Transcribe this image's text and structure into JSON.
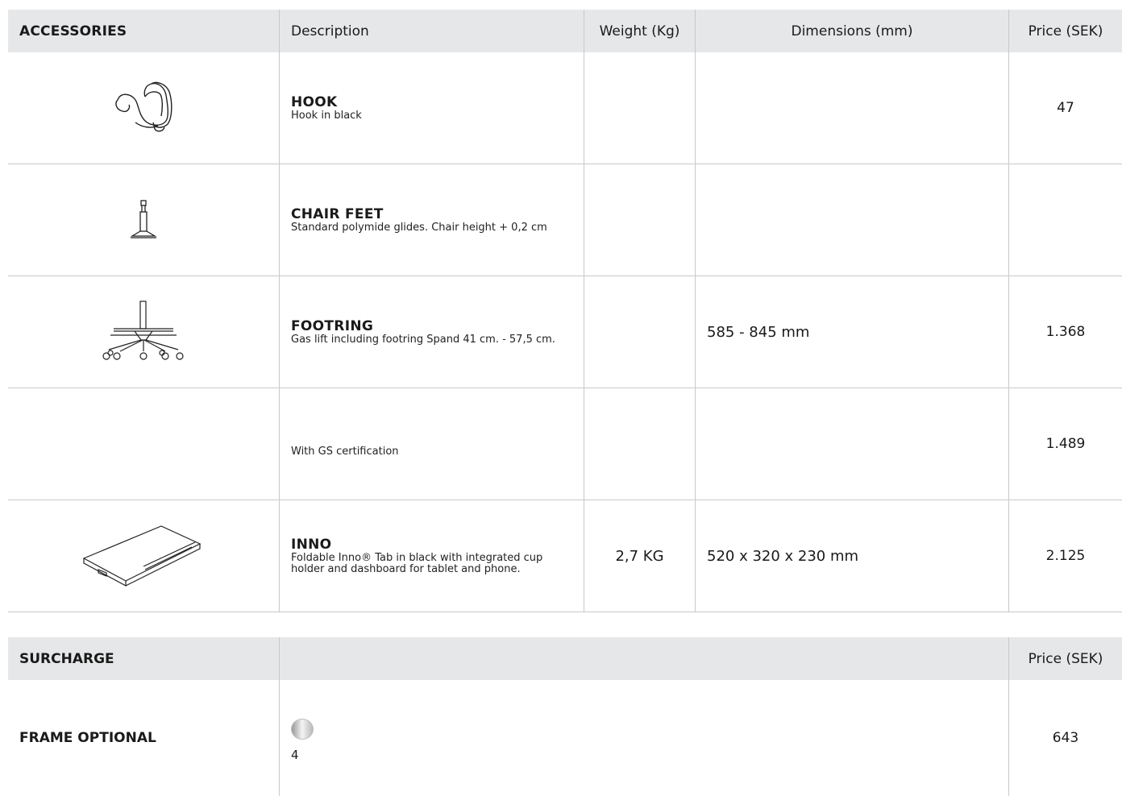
{
  "accessories": {
    "header": {
      "section": "ACCESSORIES",
      "description": "Description",
      "weight": "Weight (Kg)",
      "dimensions": "Dimensions (mm)",
      "price": "Price (SEK)"
    },
    "rows": [
      {
        "icon": "hook-icon",
        "name": "HOOK",
        "text": "Hook in black",
        "weight": "",
        "dimensions": "",
        "price": "47"
      },
      {
        "icon": "chair-feet-icon",
        "name": "CHAIR FEET",
        "text": "Standard polymide glides. Chair height + 0,2 cm",
        "weight": "",
        "dimensions": "",
        "price": ""
      },
      {
        "icon": "footring-icon",
        "name": "FOOTRING",
        "text": "Gas lift including footring Spand 41 cm. - 57,5 cm.",
        "weight": "",
        "dimensions": "585 - 845 mm",
        "price": "1.368"
      },
      {
        "icon": "",
        "name": "",
        "text": "With GS certification",
        "weight": "",
        "dimensions": "",
        "price": "1.489"
      },
      {
        "icon": "tablet-tray-icon",
        "name": "INNO",
        "text": "Foldable Inno® Tab in black with integrated cup holder and dashboard for tablet and phone.",
        "weight": "2,7 KG",
        "dimensions": "520 x 320 x 230 mm",
        "price": "2.125"
      }
    ]
  },
  "surcharge": {
    "header": {
      "section": "SURCHARGE",
      "middle": "",
      "price": "Price (SEK)"
    },
    "row": {
      "name": "FRAME OPTIONAL",
      "swatch_icon": "chrome-swatch-icon",
      "swatch_label": "4",
      "price": "643"
    }
  }
}
